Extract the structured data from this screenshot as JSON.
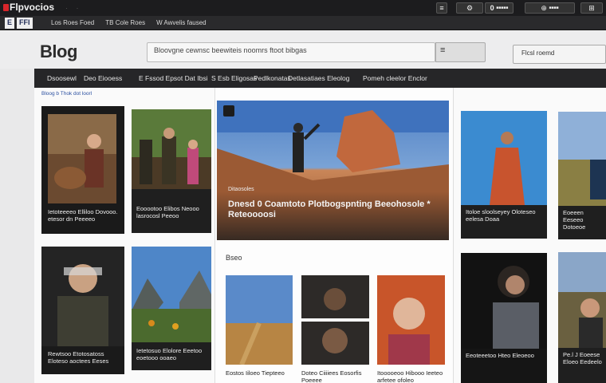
{
  "topbar": {
    "logo": "Flpvocios",
    "right_1": "≡",
    "right_2": "⚙",
    "right_3": "0",
    "right_3_text": "■■■■■",
    "right_4": "⊕",
    "right_4_text": "■■■■",
    "right_5": "⊞"
  },
  "bar2": {
    "badge_1": "E",
    "badge_2": "FFI",
    "links": [
      "Los  Roes Foed",
      "TB  Cole Roes",
      "W  Awvelis  faused"
    ]
  },
  "header": {
    "brand": "Blog",
    "search_value": "Bloovgne cewnsc  beewiteis noomrs  ftoot  bibgas",
    "search_button": "≡",
    "dropdown": "Flcsl roemd"
  },
  "nav": {
    "items": [
      "Dsoosewl",
      "Deo  Eiooess",
      "E  Fssod  Epsot  Dat  Ibsi",
      "S  Esb  Eligosas",
      "Pedlkonatas",
      "Detlasatiaes  Eleolog",
      "Pomeh  cleelor  Enclor"
    ]
  },
  "breadcrumb": {
    "text": "Bloog  b    Thok  dot  loorl"
  },
  "hero": {
    "tag": "Ditaosoles",
    "title": "Dnesd  0  Coamtoto  Plotbogspnting  Beeohosole  *  Reteoooosi"
  },
  "section": {
    "title": "Bseo"
  },
  "cards": [
    {
      "caption": "Ietoteeeeo  Elliloo  Dovooo.  etesor  dn  Peeeeo"
    },
    {
      "caption": "Eooootoo  Elibos  Neooo  lasrocosl  Peeoo"
    },
    {
      "caption": "Rewtsoo  Etotosatoss  Eloteso  aoctees  Eeses"
    },
    {
      "caption": "Ietetosuo  Elolore  Eeetoo  eoetooo  ooaeo"
    },
    {
      "caption": "Eostos  Iiloeo  Tiepteeo"
    },
    {
      "caption": "Doteo  Ciiiiees  Eosorfis  Poeeee"
    },
    {
      "caption": "Itooooeoo  Hibooo  Ieeteo  arfetee  ofoleo"
    },
    {
      "caption": "Itoloe  sloolseyey  Oloteseo  eelesa  Doaa"
    },
    {
      "caption": "Eoeeen  Eeseeo  Dotoeoe"
    },
    {
      "caption": "Eeoteeetoo  Hteo  Eleoeoo"
    },
    {
      "caption": "Pe.l  J  Eoeese  Eloeo  Eedeelo"
    }
  ],
  "colors": {
    "topbar": "#1c1c1e",
    "nav": "#262628",
    "page_bg": "#ededee",
    "brand_red": "#d8262b"
  }
}
